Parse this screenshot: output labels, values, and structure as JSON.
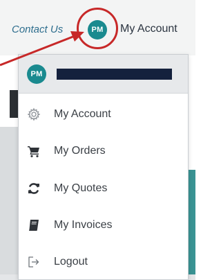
{
  "header": {
    "contact_label": "Contact Us",
    "avatar_initials": "PM",
    "account_label": "My Account"
  },
  "dropdown": {
    "avatar_initials": "PM",
    "items": [
      {
        "label": "My Account",
        "icon": "gear-icon"
      },
      {
        "label": "My Orders",
        "icon": "cart-icon"
      },
      {
        "label": "My Quotes",
        "icon": "refresh-icon"
      },
      {
        "label": "My Invoices",
        "icon": "book-icon"
      },
      {
        "label": "Logout",
        "icon": "logout-icon"
      }
    ]
  },
  "colors": {
    "avatar": "#1a8a8f",
    "highlight": "#c72828",
    "link": "#2d6d8d",
    "accent_teal": "#3a9393"
  }
}
